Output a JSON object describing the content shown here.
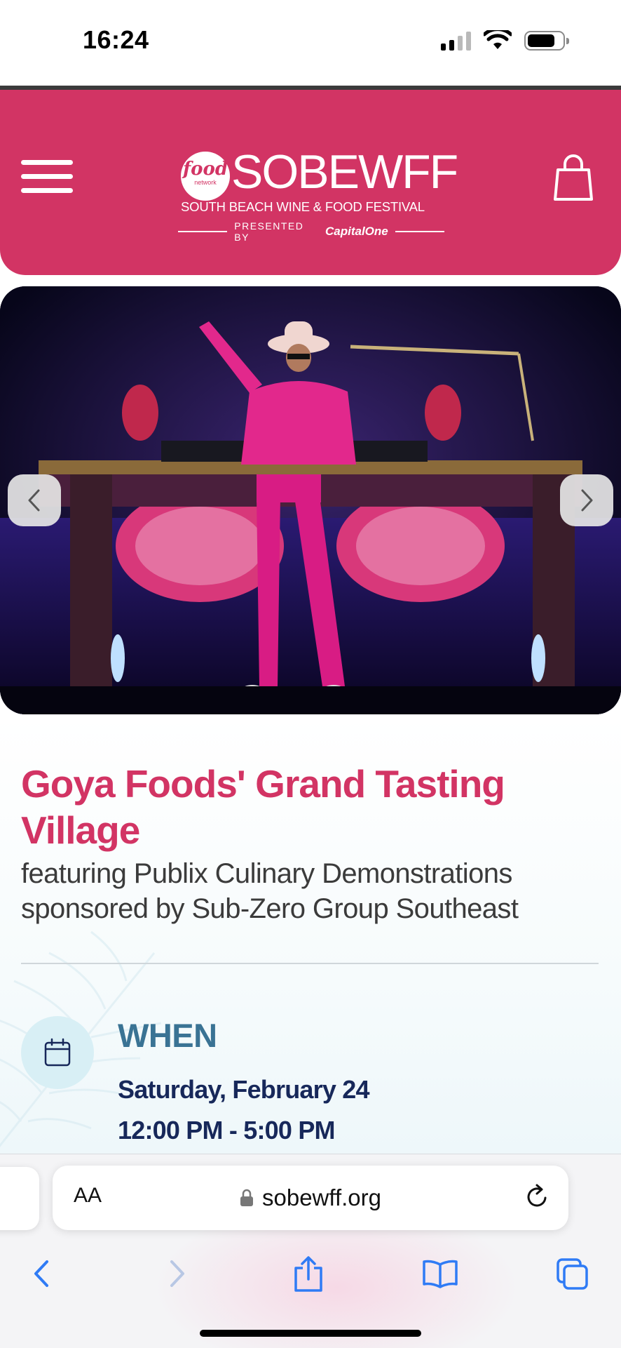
{
  "status_bar": {
    "time": "16:24",
    "icons": [
      "cellular-signal-icon",
      "wifi-icon",
      "battery-icon"
    ]
  },
  "header": {
    "menu_icon": "hamburger-menu-icon",
    "cart_icon": "shopping-bag-icon",
    "logo": {
      "badge_main": "food",
      "badge_sub": "network",
      "wordmark": "SOBEWFF",
      "tagline": "SOUTH BEACH WINE & FOOD FESTIVAL",
      "presented_by": "PRESENTED BY",
      "sponsor": "CapitalOne"
    },
    "background_color": "#d23464"
  },
  "hero": {
    "image_subject": "dj-performer-in-pink-suit-on-stage",
    "prev_icon": "chevron-left-icon",
    "next_icon": "chevron-right-icon"
  },
  "event": {
    "title": "Goya Foods' Grand Tasting Village",
    "subtitle": "featuring Publix Culinary Demonstrations sponsored by Sub-Zero Group Southeast",
    "when": {
      "icon": "calendar-icon",
      "label": "WHEN",
      "date": "Saturday, February 24",
      "time": "12:00 PM - 5:00 PM"
    }
  },
  "browser": {
    "text_size_label": "AA",
    "lock_icon": "lock-icon",
    "url": "sobewff.org",
    "reload_icon": "reload-icon",
    "toolbar": [
      "back-icon",
      "forward-icon",
      "share-icon",
      "bookmarks-icon",
      "tabs-icon"
    ]
  },
  "colors": {
    "brand_pink": "#d23464",
    "heading_blue": "#3a7394",
    "navy": "#17285a",
    "ios_blue": "#2f7bf5"
  }
}
